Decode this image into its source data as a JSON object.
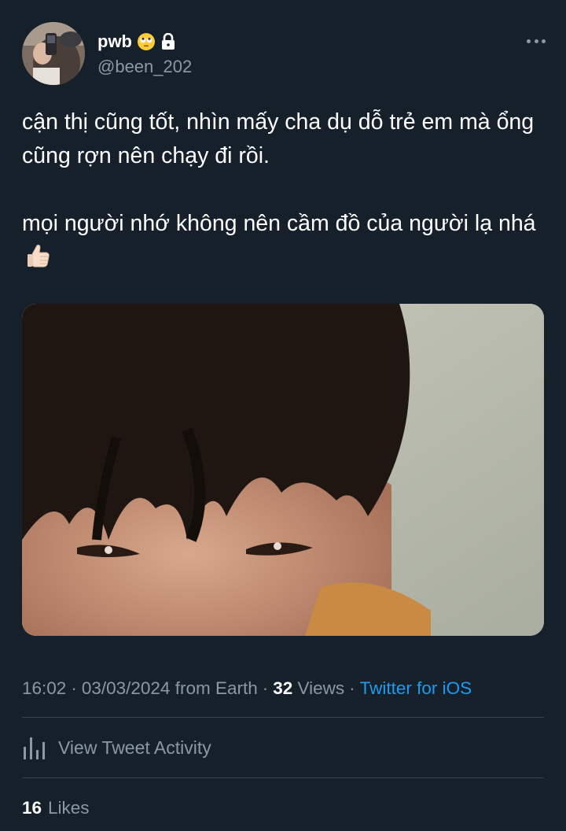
{
  "author": {
    "display_name": "pwb",
    "handle": "@been_202",
    "avatar_icon": "avatar-image",
    "emoji_icon": "rolling-eyes-face-emoji",
    "lock_icon": "lock-icon"
  },
  "tweet": {
    "text_lines": [
      "cận thị cũng tốt, nhìn mấy cha dụ dỗ trẻ em mà ổng cũng rợn nên chạy đi rồi.",
      "mọi người nhớ không nên cầm đồ của người lạ nhá"
    ],
    "trailing_emoji": "thumbs-up-emoji",
    "media_icon": "photo-closeup-face"
  },
  "meta": {
    "time": "16:02",
    "date": "03/03/2024",
    "location": "from Earth",
    "views_count": "32",
    "views_label": "Views",
    "client": "Twitter for iOS"
  },
  "activity": {
    "label": "View Tweet Activity",
    "icon": "bar-chart-icon"
  },
  "likes": {
    "count": "16",
    "label": "Likes"
  },
  "colors": {
    "background": "#15202b",
    "text_primary": "#ffffff",
    "text_secondary": "#8b98a5",
    "link": "#1d9bf0",
    "divider": "#38444d"
  }
}
